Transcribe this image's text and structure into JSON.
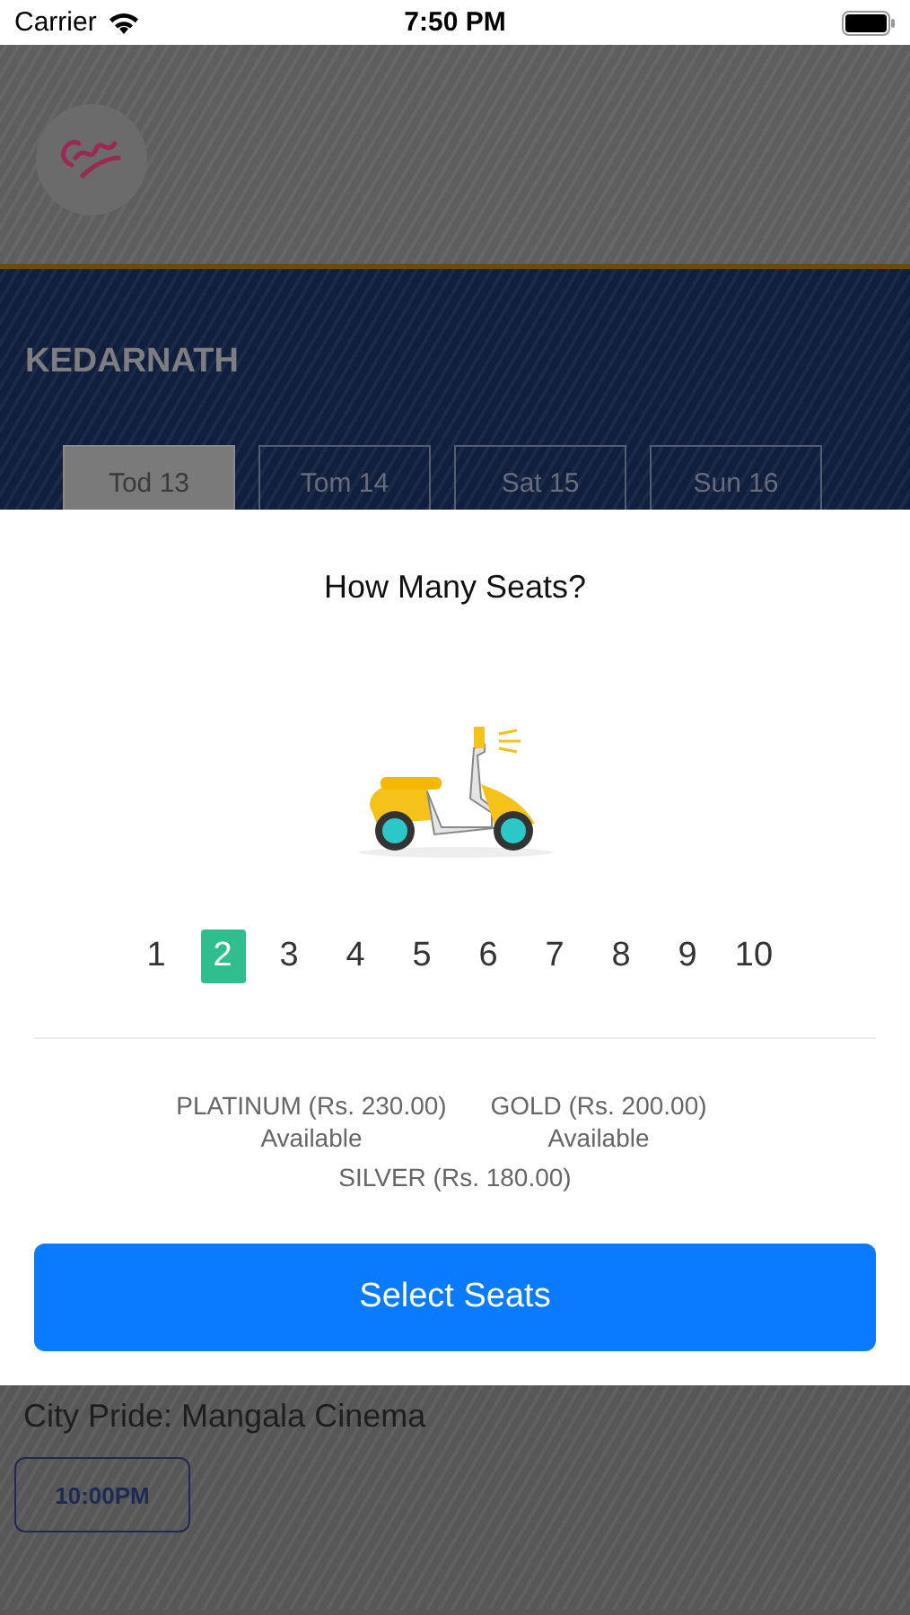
{
  "status_bar": {
    "carrier": "Carrier",
    "time": "7:50 PM"
  },
  "background": {
    "movie_title": "KEDARNATH",
    "dates": [
      {
        "label": "Tod 13",
        "selected": true
      },
      {
        "label": "Tom 14",
        "selected": false
      },
      {
        "label": "Sat 15",
        "selected": false
      },
      {
        "label": "Sun 16",
        "selected": false
      }
    ],
    "cinema": "City Pride: Mangala Cinema",
    "showtimes": [
      "10:00PM"
    ]
  },
  "sheet": {
    "title": "How Many Seats?",
    "seat_counts": [
      {
        "label": "1",
        "selected": false
      },
      {
        "label": "2",
        "selected": true
      },
      {
        "label": "3",
        "selected": false
      },
      {
        "label": "4",
        "selected": false
      },
      {
        "label": "5",
        "selected": false
      },
      {
        "label": "6",
        "selected": false
      },
      {
        "label": "7",
        "selected": false
      },
      {
        "label": "8",
        "selected": false
      },
      {
        "label": "9",
        "selected": false
      },
      {
        "label": "10",
        "selected": false
      }
    ],
    "categories": [
      {
        "name": "PLATINUM (Rs. 230.00)",
        "status": "Available"
      },
      {
        "name": "GOLD (Rs. 200.00)",
        "status": "Available"
      },
      {
        "name": "SILVER (Rs. 180.00)"
      }
    ],
    "button": "Select Seats"
  }
}
